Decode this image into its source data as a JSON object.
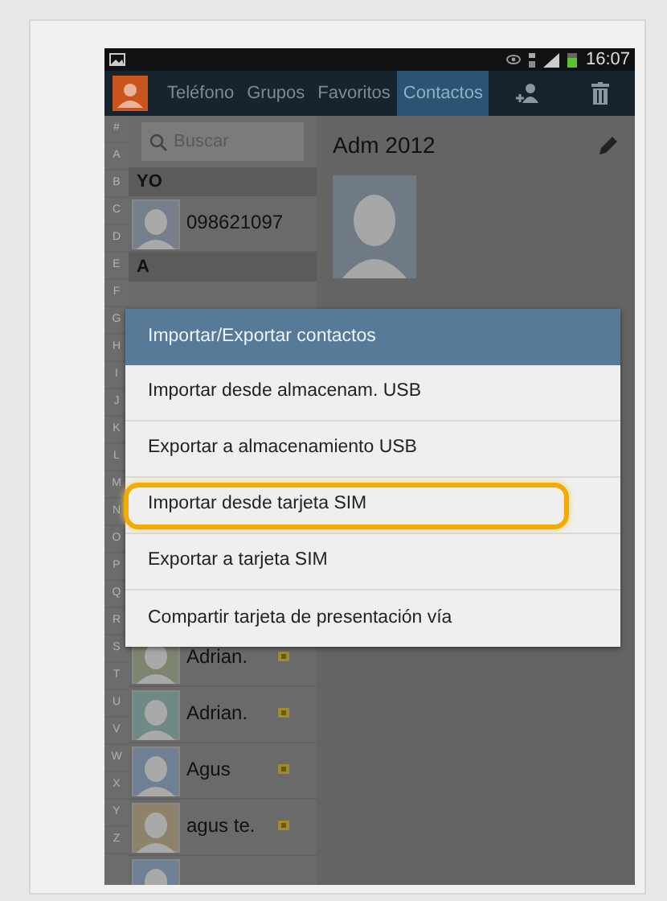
{
  "status_bar": {
    "time": "16:07"
  },
  "action_bar": {
    "tabs": [
      {
        "label": "Teléfono",
        "selected": false
      },
      {
        "label": "Grupos",
        "selected": false
      },
      {
        "label": "Favoritos",
        "selected": false
      },
      {
        "label": "Contactos",
        "selected": true
      }
    ]
  },
  "index_letters": [
    "#",
    "A",
    "B",
    "C",
    "D",
    "E",
    "F",
    "G",
    "H",
    "I",
    "J",
    "K",
    "L",
    "M",
    "N",
    "O",
    "P",
    "Q",
    "R",
    "S",
    "T",
    "U",
    "V",
    "W",
    "X",
    "Y",
    "Z"
  ],
  "search": {
    "placeholder": "Buscar"
  },
  "contacts_top": [
    {
      "kind": "header",
      "label": "YO"
    },
    {
      "kind": "contact",
      "name": "098621097",
      "color": "#75808c",
      "sim": false
    },
    {
      "kind": "header",
      "label": "A"
    }
  ],
  "contacts_bottom": [
    {
      "kind": "contact",
      "name": "Adrian.",
      "color": "#7d8470",
      "sim": true
    },
    {
      "kind": "contact",
      "name": "Adrian.",
      "color": "#6f8a86",
      "sim": true
    },
    {
      "kind": "contact",
      "name": "Agus",
      "color": "#6f7f94",
      "sim": true
    },
    {
      "kind": "contact",
      "name": "agus te.",
      "color": "#8f826a",
      "sim": true
    },
    {
      "kind": "contact",
      "color": "#6f7f94",
      "sim": false
    }
  ],
  "detail": {
    "name": "Adm 2012"
  },
  "dialog": {
    "title": "Importar/Exportar contactos",
    "items": [
      {
        "label": "Importar desde almacenam. USB",
        "highlighted": false
      },
      {
        "label": "Exportar a almacenamiento USB",
        "highlighted": false
      },
      {
        "label": "Importar desde tarjeta SIM",
        "highlighted": true
      },
      {
        "label": "Exportar a tarjeta SIM",
        "highlighted": false
      },
      {
        "label": "Compartir tarjeta de presentación vía",
        "highlighted": false
      }
    ]
  }
}
